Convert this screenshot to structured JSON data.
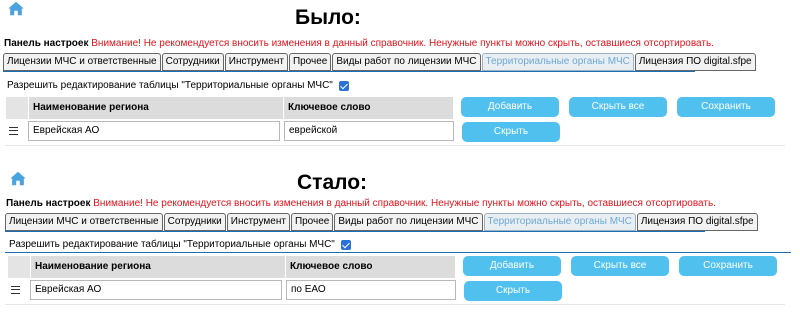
{
  "accent_color": "#50c0ef",
  "warning_color": "#e0141c",
  "sections": [
    {
      "title": "Было:",
      "panel_label": "Панель настроек",
      "warning": "Внимание! Не рекомендуется вносить изменения в данный справочник. Ненужные пункты можно скрыть, оставшиеся отсортировать.",
      "tabs": [
        "Лицензии МЧС и ответственные",
        "Сотрудники",
        "Инструмент",
        "Прочее",
        "Виды работ по лицензии МЧС",
        "Территориальные органы МЧС",
        "Лицензия ПО digital.sfpe"
      ],
      "active_tab": "Территориальные органы МЧС",
      "allow_edit_label": "Разрешить редактирование таблицы \"Территориальные органы МЧС\"",
      "allow_edit_checked": true,
      "columns": [
        "Наименование региона",
        "Ключевое слово"
      ],
      "buttons": {
        "add": "Добавить",
        "hide_all": "Скрыть все",
        "save": "Сохранить"
      },
      "row": {
        "region": "Еврейская АО",
        "keyword": "еврейской",
        "hide": "Скрыть"
      }
    },
    {
      "title": "Стало:",
      "panel_label": "Панель настроек",
      "warning": "Внимание! Не рекомендуется вносить изменения в данный справочник. Ненужные пункты можно скрыть, оставшиеся отсортировать.",
      "tabs": [
        "Лицензии МЧС и ответственные",
        "Сотрудники",
        "Инструмент",
        "Прочее",
        "Виды работ по лицензии МЧС",
        "Территориальные органы МЧС",
        "Лицензия ПО digital.sfpe"
      ],
      "active_tab": "Территориальные органы МЧС",
      "allow_edit_label": "Разрешить редактирование таблицы \"Территориальные органы МЧС\"",
      "allow_edit_checked": true,
      "columns": [
        "Наименование региона",
        "Ключевое слово"
      ],
      "buttons": {
        "add": "Добавить",
        "hide_all": "Скрыть все",
        "save": "Сохранить"
      },
      "row": {
        "region": "Еврейская АО",
        "keyword": "по ЕАО",
        "hide": "Скрыть"
      }
    }
  ]
}
